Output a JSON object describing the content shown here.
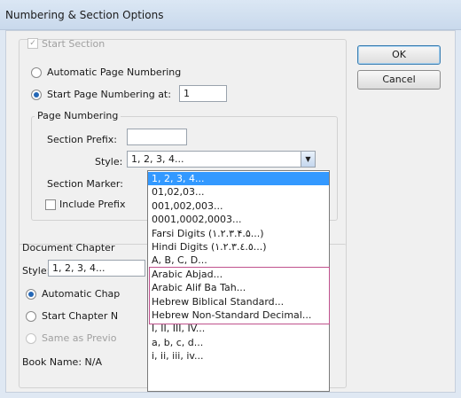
{
  "window": {
    "title": "Numbering & Section Options"
  },
  "buttons": {
    "ok": "OK",
    "cancel": "Cancel"
  },
  "start_section": {
    "label": "Start Section",
    "checked": true,
    "enabled": false
  },
  "numbering": {
    "automatic_label": "Automatic Page Numbering",
    "start_at_label": "Start Page Numbering at:",
    "start_at_value": "1",
    "selected": "start_at"
  },
  "page_numbering": {
    "group_label": "Page Numbering",
    "section_prefix_label": "Section Prefix:",
    "section_prefix_value": "",
    "style_label": "Style:",
    "style_value": "1, 2, 3, 4...",
    "section_marker_label": "Section Marker:",
    "include_prefix_label": "Include Prefix"
  },
  "style_options": [
    "1, 2, 3, 4...",
    "01,02,03...",
    "001,002,003...",
    "0001,0002,0003...",
    "Farsi Digits (١.٢.٣.۴.۵...)",
    "Hindi Digits (١.٢.٣.٤.٥...)",
    "A, B, C, D...",
    "Arabic Abjad...",
    "Arabic Alif Ba Tah...",
    "Hebrew Biblical Standard...",
    "Hebrew Non-Standard Decimal...",
    "I, II, III, IV...",
    "a, b, c, d...",
    "i, ii, iii, iv..."
  ],
  "selected_option_index": 0,
  "document_chapter": {
    "group_label": "Document Chapter",
    "style_label": "Style:",
    "style_value": "1, 2, 3, 4...",
    "automatic_label": "Automatic Chap",
    "start_label": "Start Chapter N",
    "same_as_label": "Same as Previo",
    "book_name": "Book Name: N/A"
  },
  "colors": {
    "selection": "#3399ff",
    "highlight_box": "#c0528d"
  }
}
